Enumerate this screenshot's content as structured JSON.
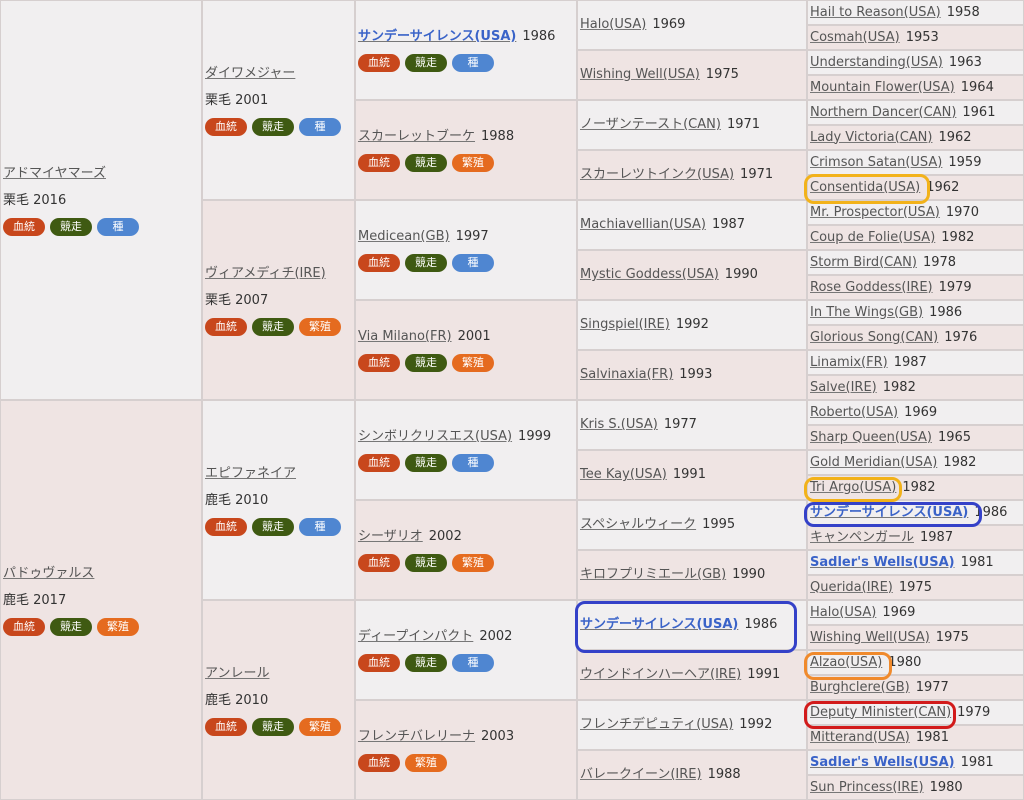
{
  "badge_labels": {
    "blood": "血統",
    "race": "競走",
    "sire": "種",
    "broodmare": "繁殖"
  },
  "colors": {
    "blood": "#c8471c",
    "race": "#3f5a12",
    "sire": "#4f86d1",
    "broodmare": "#e56b1f",
    "highlight_yellow": "#f2b21a",
    "highlight_blue": "#3441c8",
    "highlight_orange": "#f08a2c",
    "highlight_red": "#d21b1b"
  },
  "col1": [
    {
      "name": "アドマイヤマーズ",
      "sub": "栗毛 2016",
      "badges": [
        "blood",
        "race",
        "sire"
      ]
    },
    {
      "name": "パドゥヴァルス",
      "sub": "鹿毛 2017",
      "badges": [
        "blood",
        "race",
        "broodmare"
      ]
    }
  ],
  "col2": [
    {
      "name": "ダイワメジャー",
      "sub": "栗毛 2001",
      "badges": [
        "blood",
        "race",
        "sire"
      ]
    },
    {
      "name": "ヴィアメディチ(IRE)",
      "sub": "栗毛 2007",
      "badges": [
        "blood",
        "race",
        "broodmare"
      ]
    },
    {
      "name": "エピファネイア",
      "sub": "鹿毛 2010",
      "badges": [
        "blood",
        "race",
        "sire"
      ]
    },
    {
      "name": "アンレール",
      "sub": "鹿毛 2010",
      "badges": [
        "blood",
        "race",
        "broodmare"
      ]
    }
  ],
  "col3": [
    {
      "name": "サンデーサイレンス(USA)",
      "year": "1986",
      "bold": true,
      "badges": [
        "blood",
        "race",
        "sire"
      ]
    },
    {
      "name": "スカーレットブーケ",
      "year": "1988",
      "badges": [
        "blood",
        "race",
        "broodmare"
      ]
    },
    {
      "name": "Medicean(GB)",
      "year": "1997",
      "badges": [
        "blood",
        "race",
        "sire"
      ]
    },
    {
      "name": "Via Milano(FR)",
      "year": "2001",
      "badges": [
        "blood",
        "race",
        "broodmare"
      ]
    },
    {
      "name": "シンボリクリスエス(USA)",
      "year": "1999",
      "badges": [
        "blood",
        "race",
        "sire"
      ]
    },
    {
      "name": "シーザリオ",
      "year": "2002",
      "badges": [
        "blood",
        "race",
        "broodmare"
      ]
    },
    {
      "name": "ディープインパクト",
      "year": "2002",
      "badges": [
        "blood",
        "race",
        "sire"
      ]
    },
    {
      "name": "フレンチバレリーナ",
      "year": "2003",
      "badges": [
        "blood",
        "broodmare"
      ]
    }
  ],
  "col4": [
    {
      "name": "Halo(USA)",
      "year": "1969"
    },
    {
      "name": "Wishing Well(USA)",
      "year": "1975"
    },
    {
      "name": "ノーザンテースト(CAN)",
      "year": "1971"
    },
    {
      "name": "スカーレツトインク(USA)",
      "year": "1971"
    },
    {
      "name": "Machiavellian(USA)",
      "year": "1987"
    },
    {
      "name": "Mystic Goddess(USA)",
      "year": "1990"
    },
    {
      "name": "Singspiel(IRE)",
      "year": "1992"
    },
    {
      "name": "Salvinaxia(FR)",
      "year": "1993"
    },
    {
      "name": "Kris S.(USA)",
      "year": "1977"
    },
    {
      "name": "Tee Kay(USA)",
      "year": "1991"
    },
    {
      "name": "スペシャルウィーク",
      "year": "1995"
    },
    {
      "name": "キロフプリミエール(GB)",
      "year": "1990"
    },
    {
      "name": "サンデーサイレンス(USA)",
      "year": "1986",
      "bold": true
    },
    {
      "name": "ウインドインハーヘア(IRE)",
      "year": "1991"
    },
    {
      "name": "フレンチデピュティ(USA)",
      "year": "1992"
    },
    {
      "name": "バレークイーン(IRE)",
      "year": "1988"
    }
  ],
  "col5": [
    {
      "name": "Hail to Reason(USA)",
      "year": "1958"
    },
    {
      "name": "Cosmah(USA)",
      "year": "1953"
    },
    {
      "name": "Understanding(USA)",
      "year": "1963"
    },
    {
      "name": "Mountain Flower(USA)",
      "year": "1964"
    },
    {
      "name": "Northern Dancer(CAN)",
      "year": "1961"
    },
    {
      "name": "Lady Victoria(CAN)",
      "year": "1962"
    },
    {
      "name": "Crimson Satan(USA)",
      "year": "1959"
    },
    {
      "name": "Consentida(USA)",
      "year": "1962"
    },
    {
      "name": "Mr. Prospector(USA)",
      "year": "1970"
    },
    {
      "name": "Coup de Folie(USA)",
      "year": "1982"
    },
    {
      "name": "Storm Bird(CAN)",
      "year": "1978"
    },
    {
      "name": "Rose Goddess(IRE)",
      "year": "1979"
    },
    {
      "name": "In The Wings(GB)",
      "year": "1986"
    },
    {
      "name": "Glorious Song(CAN)",
      "year": "1976"
    },
    {
      "name": "Linamix(FR)",
      "year": "1987"
    },
    {
      "name": "Salve(IRE)",
      "year": "1982"
    },
    {
      "name": "Roberto(USA)",
      "year": "1969"
    },
    {
      "name": "Sharp Queen(USA)",
      "year": "1965"
    },
    {
      "name": "Gold Meridian(USA)",
      "year": "1982"
    },
    {
      "name": "Tri Argo(USA)",
      "year": "1982"
    },
    {
      "name": "サンデーサイレンス(USA)",
      "year": "1986",
      "bold": true
    },
    {
      "name": "キャンペンガール",
      "year": "1987"
    },
    {
      "name": "Sadler's Wells(USA)",
      "year": "1981",
      "bold": true
    },
    {
      "name": "Querida(IRE)",
      "year": "1975"
    },
    {
      "name": "Halo(USA)",
      "year": "1969"
    },
    {
      "name": "Wishing Well(USA)",
      "year": "1975"
    },
    {
      "name": "Alzao(USA)",
      "year": "1980"
    },
    {
      "name": "Burghclere(GB)",
      "year": "1977"
    },
    {
      "name": "Deputy Minister(CAN)",
      "year": "1979"
    },
    {
      "name": "Mitterand(USA)",
      "year": "1981"
    },
    {
      "name": "Sadler's Wells(USA)",
      "year": "1981",
      "bold": true
    },
    {
      "name": "Sun Princess(IRE)",
      "year": "1980"
    }
  ],
  "highlights": [
    {
      "id": "consentida",
      "color": "highlight_yellow"
    },
    {
      "id": "tri-argo",
      "color": "highlight_yellow"
    },
    {
      "id": "sunday-silence-col5",
      "color": "highlight_blue"
    },
    {
      "id": "sunday-silence-col4",
      "color": "highlight_blue"
    },
    {
      "id": "alzao",
      "color": "highlight_orange"
    },
    {
      "id": "deputy-minister",
      "color": "highlight_red"
    }
  ]
}
